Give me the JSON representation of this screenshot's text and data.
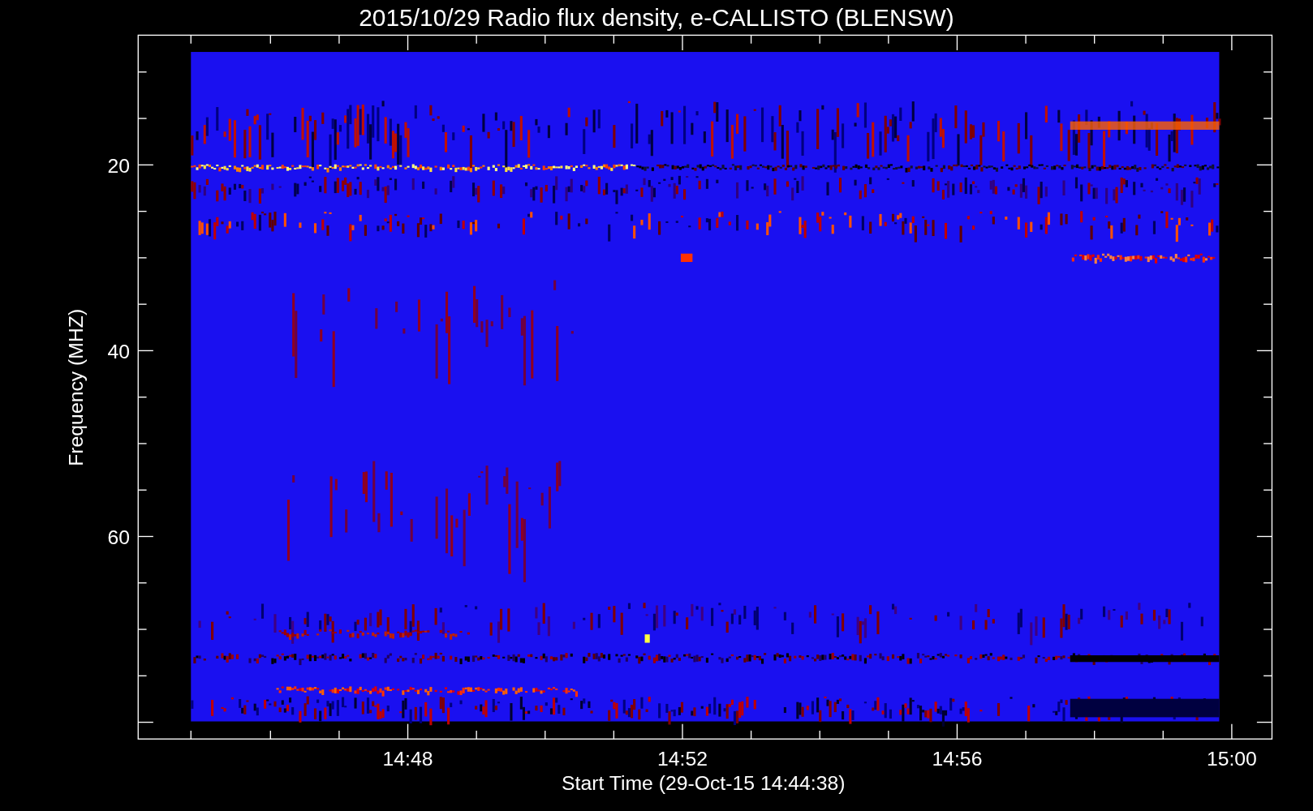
{
  "title": "2015/10/29  Radio flux density, e-CALLISTO (BLENSW)",
  "xlabel": "Start Time (29-Oct-15 14:44:38)",
  "ylabel": "Frequency (MHZ)",
  "xticks": [
    "14:48",
    "14:52",
    "14:56",
    "15:00"
  ],
  "yticks": [
    "20",
    "40",
    "60"
  ]
}
